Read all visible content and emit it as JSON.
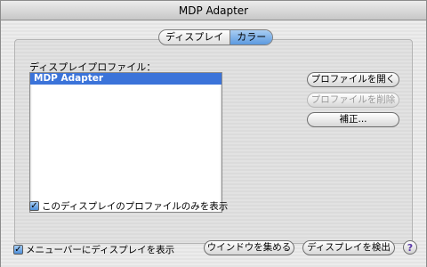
{
  "window": {
    "title": "MDP Adapter"
  },
  "tabs": [
    {
      "label": "ディスプレイ",
      "selected": false
    },
    {
      "label": "カラー",
      "selected": true
    }
  ],
  "color_panel": {
    "profile_label": "ディスプレイプロファイル：",
    "profiles": [
      "MDP Adapter"
    ],
    "selected_profile": "MDP Adapter",
    "open_profile_button": "プロファイルを開く",
    "delete_profile_button": "プロファイルを削除",
    "calibrate_button": "補正...",
    "show_only_checkbox": {
      "label": "このディスプレイのプロファイルのみを表示",
      "checked": true
    }
  },
  "footer": {
    "menubar_checkbox": {
      "label": "メニューバーにディスプレイを表示",
      "checked": true
    },
    "gather_windows_button": "ウインドウを集める",
    "detect_displays_button": "ディスプレイを検出",
    "help_glyph": "?"
  },
  "colors": {
    "selection_blue": "#3b73d9",
    "accent_blue": "#5c9ae0"
  }
}
